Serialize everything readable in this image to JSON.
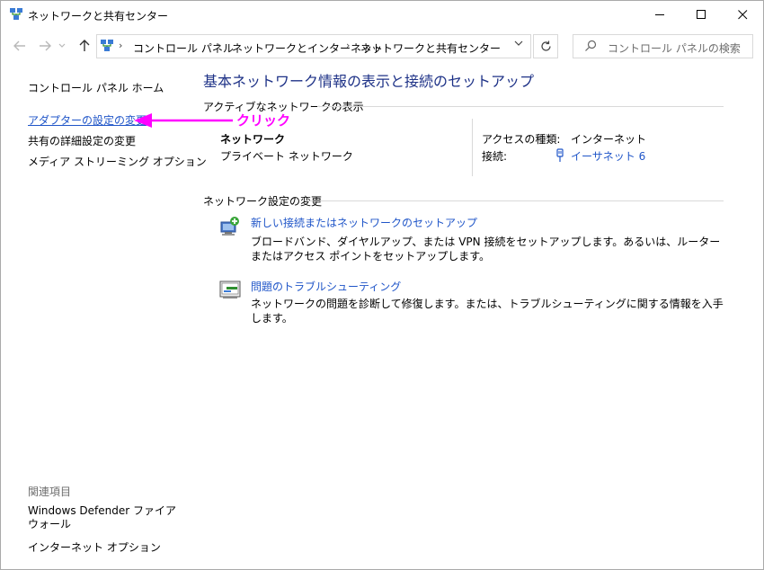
{
  "window": {
    "title": "ネットワークと共有センター",
    "icon": "network-center-icon",
    "minimize_icon": "minimize-icon",
    "maximize_icon": "maximize-icon",
    "close_icon": "close-icon"
  },
  "nav": {
    "back_icon": "arrow-left-icon",
    "forward_icon": "arrow-right-icon",
    "recent_icon": "chevron-down-icon",
    "up_icon": "arrow-up-icon",
    "breadcrumbs": [
      "コントロール パネル",
      "ネットワークとインターネット",
      "ネットワークと共有センター"
    ],
    "refresh_icon": "refresh-icon",
    "search_placeholder": "コントロール パネルの検索"
  },
  "sidebar": {
    "home": "コントロール パネル ホーム",
    "items": [
      "アダプターの設定の変更",
      "共有の詳細設定の変更",
      "メディア ストリーミング オプション"
    ],
    "related_heading": "関連項目",
    "related": [
      "Windows Defender ファイアウォール",
      "インターネット オプション"
    ]
  },
  "annotation": {
    "label": "クリック",
    "color": "#ff00ff"
  },
  "main": {
    "title": "基本ネットワーク情報の表示と接続のセットアップ",
    "active_heading": "アクティブなネットワークの表示",
    "network_name": "ネットワーク",
    "network_type": "プライベート ネットワーク",
    "access_label": "アクセスの種類:",
    "access_value": "インターネット",
    "connection_label": "接続:",
    "connection_value": "イーサネット 6",
    "settings_heading": "ネットワーク設定の変更",
    "tasks": [
      {
        "title": "新しい接続またはネットワークのセットアップ",
        "desc": "ブロードバンド、ダイヤルアップ、または VPN 接続をセットアップします。あるいは、ルーターまたはアクセス ポイントをセットアップします。",
        "icon": "new-connection-icon"
      },
      {
        "title": "問題のトラブルシューティング",
        "desc": "ネットワークの問題を診断して修復します。または、トラブルシューティングに関する情報を入手します。",
        "icon": "troubleshoot-icon"
      }
    ]
  },
  "colors": {
    "link": "#1f55c8",
    "title": "#1e3287",
    "annotation": "#ff00ff"
  }
}
